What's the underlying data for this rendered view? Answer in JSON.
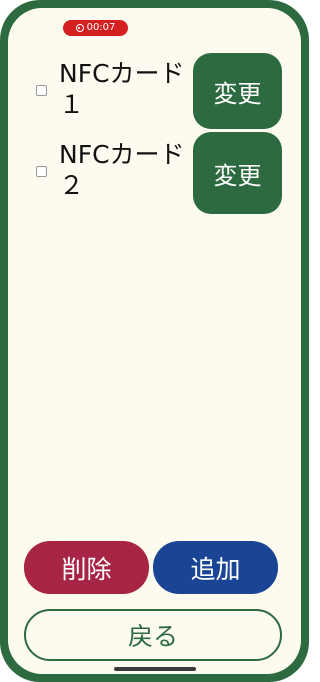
{
  "status": {
    "recording_time": "00:07",
    "recording_icon": "record-icon"
  },
  "cards": [
    {
      "label": "NFCカード１",
      "change_label": "変更",
      "checked": false
    },
    {
      "label": "NFCカード ２",
      "change_label": "変更",
      "checked": false
    }
  ],
  "actions": {
    "delete_label": "削除",
    "add_label": "追加",
    "back_label": "戻る"
  },
  "colors": {
    "primary_green": "#2d6a40",
    "delete_red": "#a82445",
    "add_blue": "#1a4595",
    "background": "#fdfbef",
    "recording_red": "#d32020"
  }
}
